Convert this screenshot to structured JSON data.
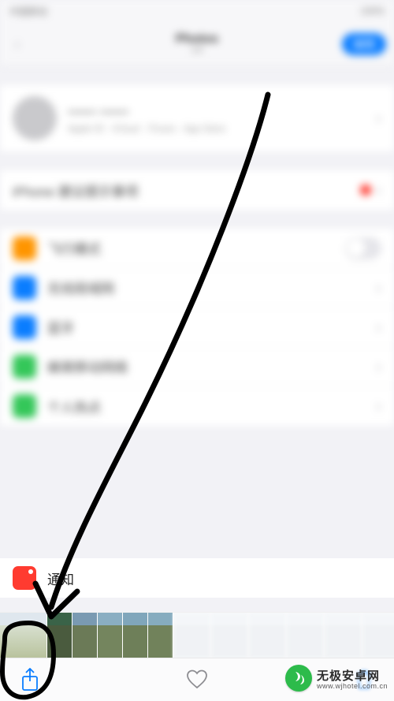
{
  "status": {
    "carrier": "中国移动",
    "battery": "100%"
  },
  "header": {
    "title_line1": "Photos",
    "title_line2": "1/5",
    "back_label": "‹",
    "edit_label": "编辑"
  },
  "profile": {
    "name": "—— ——",
    "sub": "Apple ID · iCloud · iTunes · App Store"
  },
  "alert_row": {
    "label": "iPhone 建议提示事项"
  },
  "rows": {
    "airplane": {
      "label": "飞行模式"
    },
    "wifi": {
      "label": "无线局域网"
    },
    "bt": {
      "label": "蓝牙"
    },
    "cellular": {
      "label": "蜂窝移动网络"
    },
    "hotspot": {
      "label": "个人热点"
    }
  },
  "notif": {
    "label": "通知"
  },
  "toolbar": {
    "share": "share",
    "like": "like",
    "delete": "delete"
  },
  "watermark": {
    "cn": "无极安卓网",
    "en": "www.wjhotel.com.cn"
  },
  "annotation": {
    "type": "arrow",
    "target": "share-button"
  }
}
